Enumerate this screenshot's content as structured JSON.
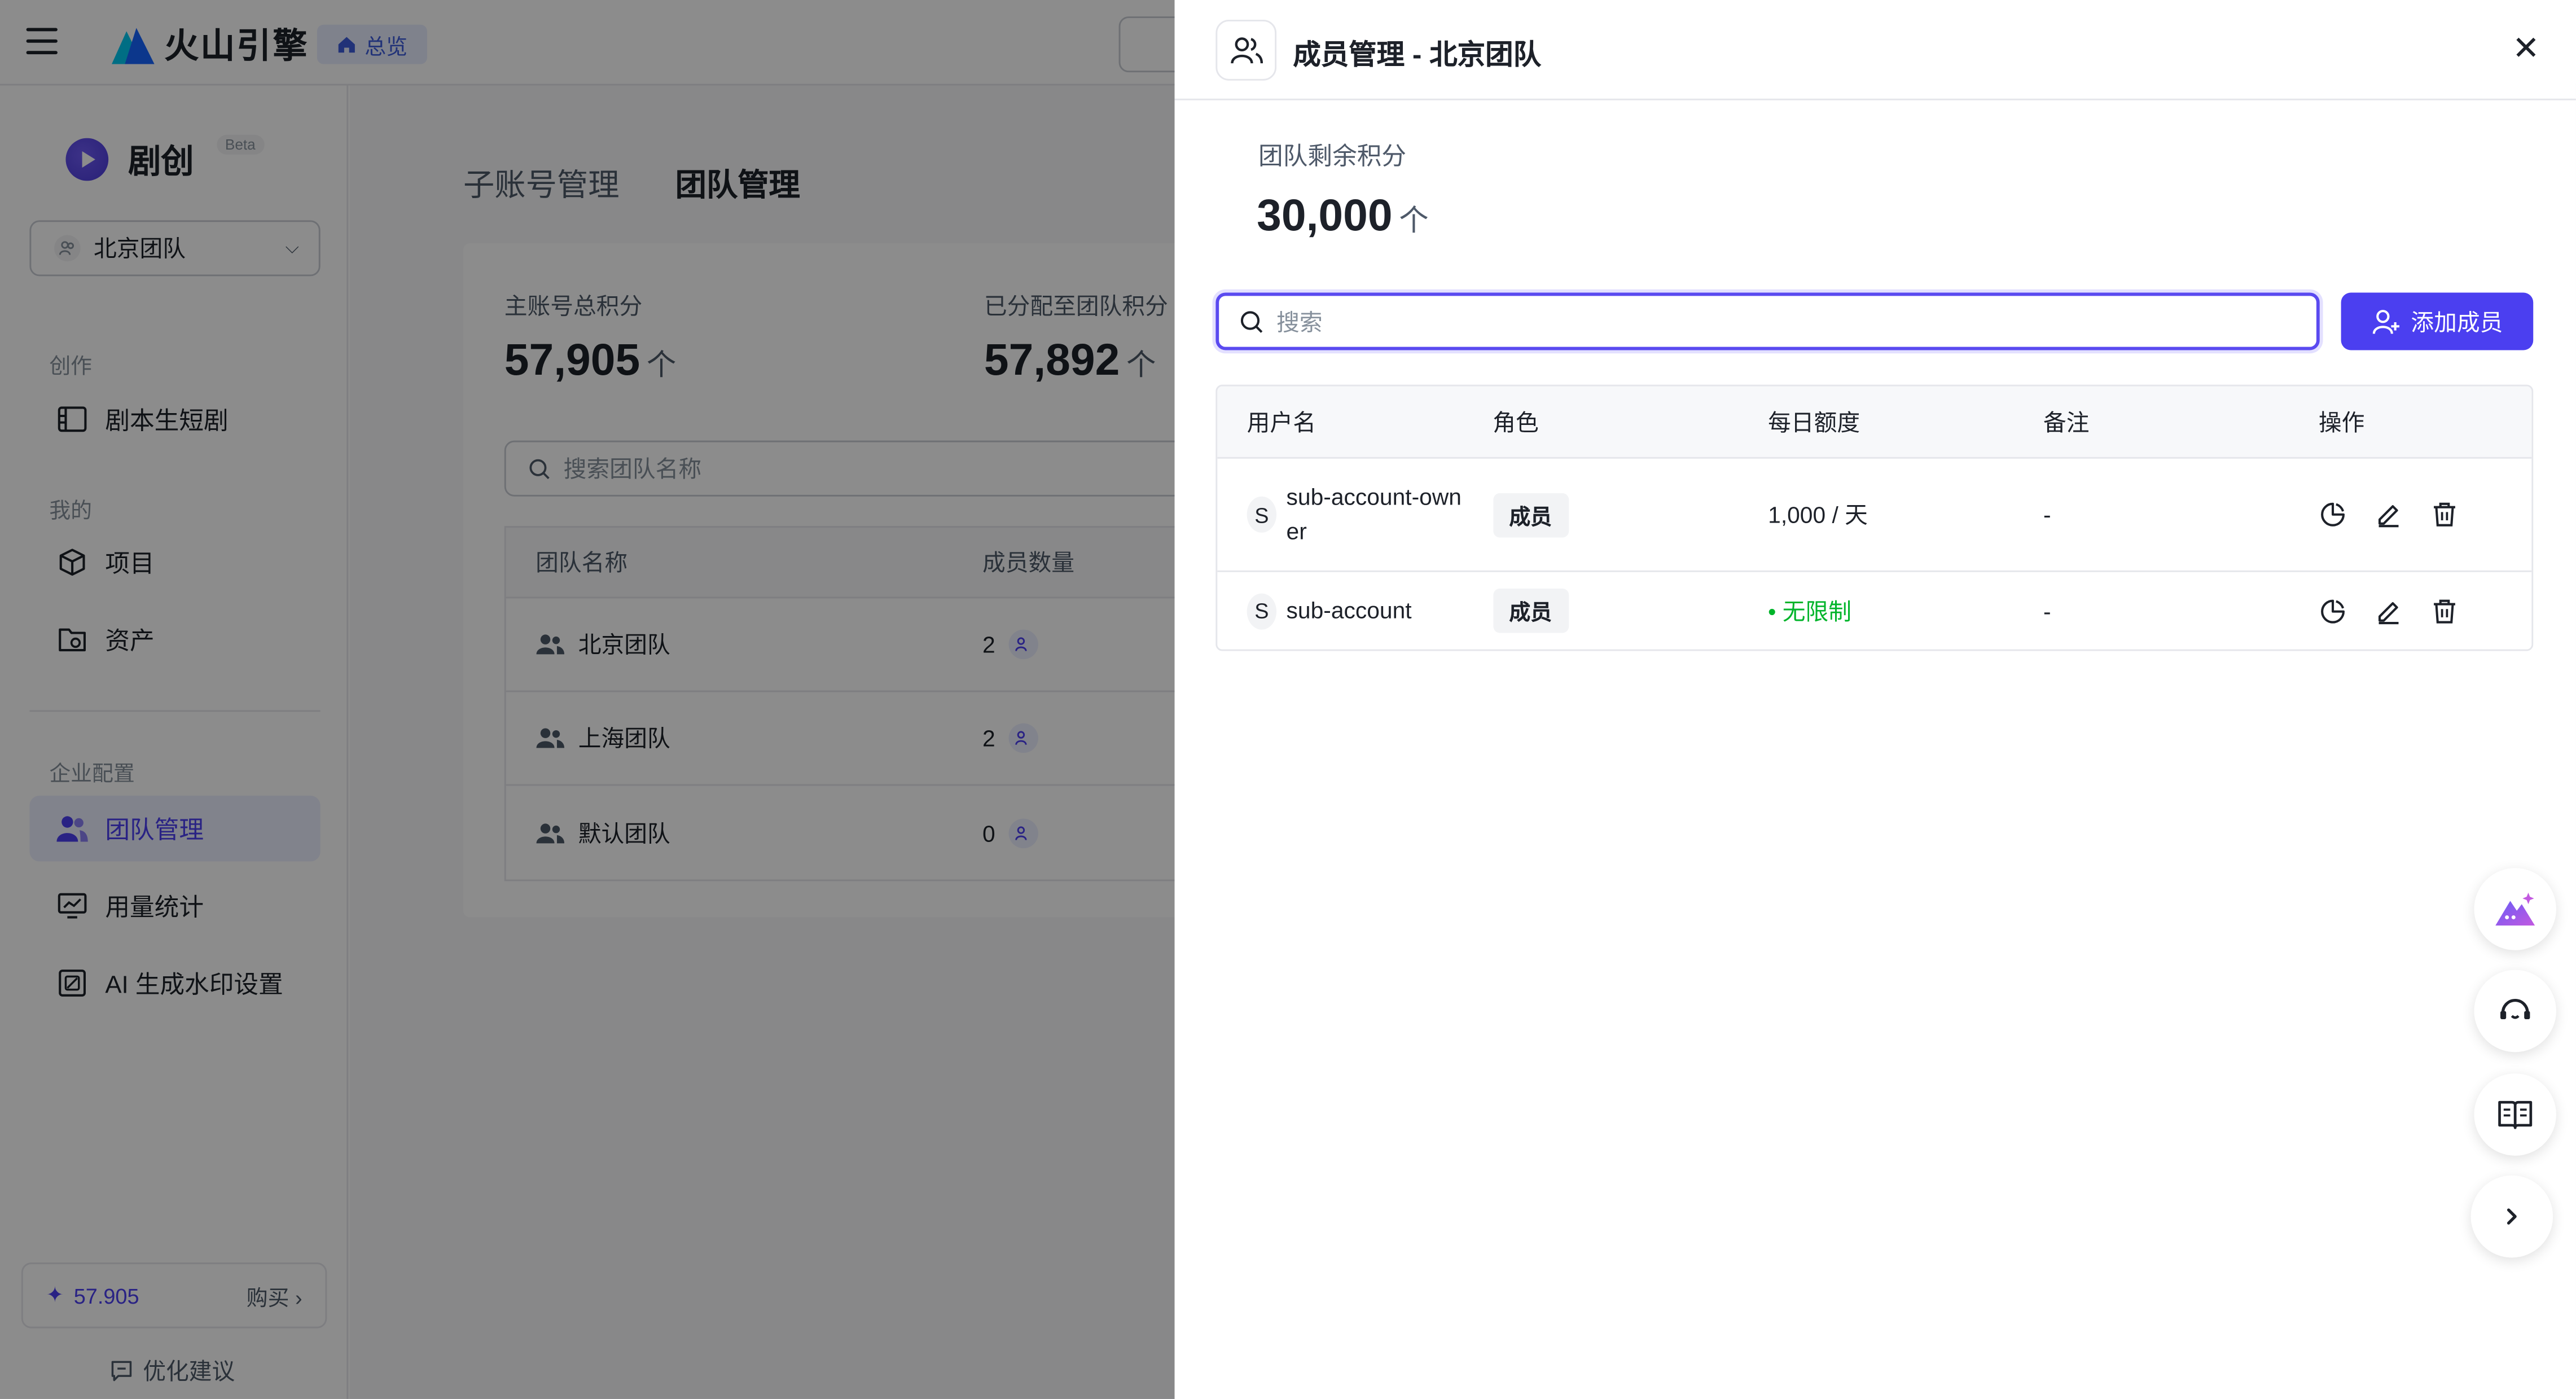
{
  "topbar": {
    "brand": "火山引擎",
    "overview_label": "总览"
  },
  "sidebar": {
    "app_name": "剧创",
    "badge": "Beta",
    "team_select": "北京团队",
    "sections": {
      "create": "创作",
      "mine": "我的",
      "enterprise": "企业配置"
    },
    "items": {
      "script_drama": "剧本生短剧",
      "projects": "项目",
      "assets": "资产",
      "team_mgmt": "团队管理",
      "usage": "用量统计",
      "watermark": "AI 生成水印设置"
    },
    "credits": "57.905",
    "buy_label": "购买",
    "feedback_label": "优化建议"
  },
  "main": {
    "tabs": [
      "子账号管理",
      "团队管理"
    ],
    "total_label": "主账号总积分",
    "total_value": "57,905",
    "allocated_label": "已分配至团队积分",
    "allocated_value": "57,892",
    "unit": "个",
    "search_placeholder": "搜索团队名称",
    "columns": [
      "团队名称",
      "成员数量"
    ],
    "teams": [
      {
        "name": "北京团队",
        "count": "2"
      },
      {
        "name": "上海团队",
        "count": "2"
      },
      {
        "name": "默认团队",
        "count": "0"
      }
    ]
  },
  "drawer": {
    "title": "成员管理 - 北京团队",
    "remaining_label": "团队剩余积分",
    "remaining_value": "30,000",
    "unit": "个",
    "search_placeholder": "搜索",
    "add_button": "添加成员",
    "columns": [
      "用户名",
      "角色",
      "每日额度",
      "备注",
      "操作"
    ],
    "members": [
      {
        "initial": "S",
        "username": "sub-account-owner",
        "role": "成员",
        "quota": "1,000 / 天",
        "note": "-"
      },
      {
        "initial": "S",
        "username": "sub-account",
        "role": "成员",
        "quota": "无限制",
        "note": "-"
      }
    ]
  },
  "colors": {
    "accent": "#4b3ff0",
    "success": "#00b42a"
  },
  "icons": [
    "menu-icon",
    "home-icon",
    "search-icon",
    "people-icon",
    "close-icon",
    "add-user-icon",
    "pie-chart-icon",
    "edit-icon",
    "trash-icon",
    "sparkle-icon",
    "support-icon",
    "book-icon",
    "chevron-right-icon"
  ]
}
